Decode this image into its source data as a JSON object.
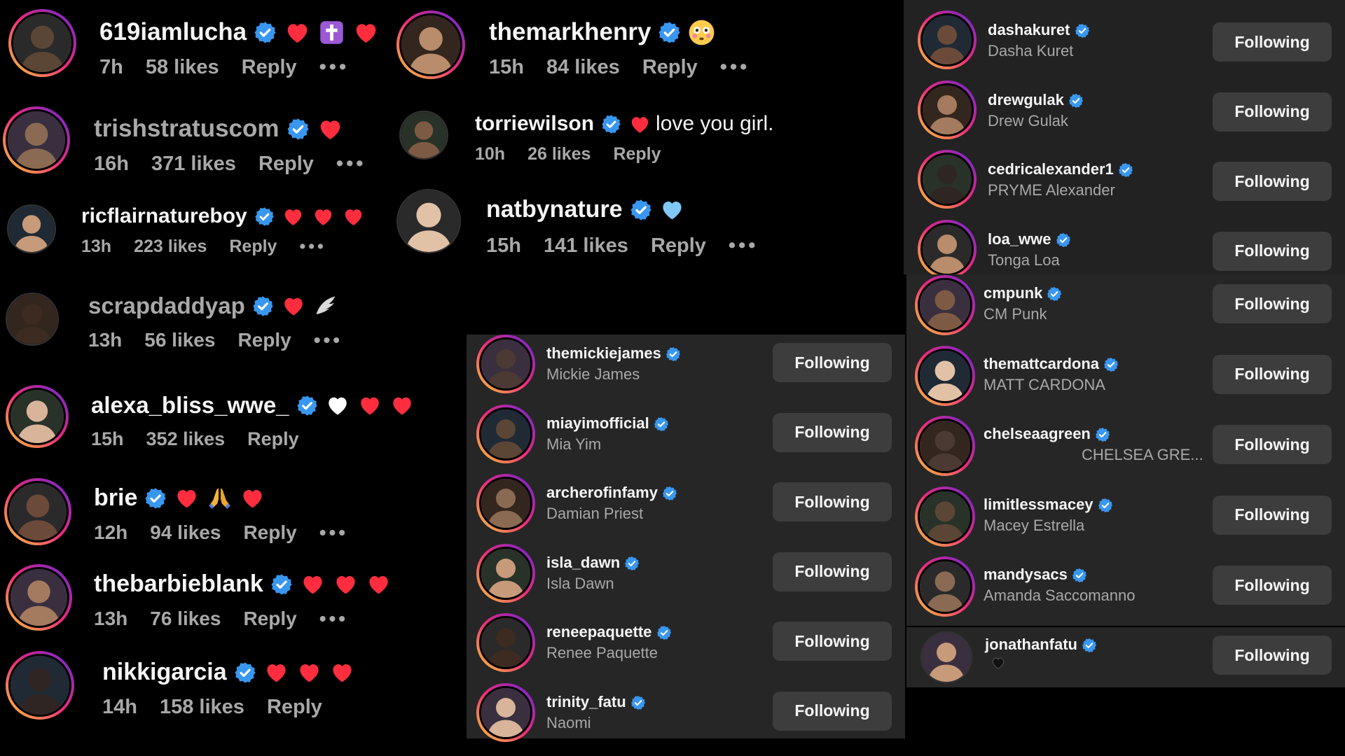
{
  "comments_col1": [
    {
      "user": "619iamlucha",
      "text": "",
      "time": "7h",
      "likes": "58 likes",
      "reply": "Reply",
      "emojis": [
        "heart-icon",
        "cross-icon",
        "heart-icon"
      ]
    },
    {
      "user": "trishstratuscom",
      "text": "",
      "time": "16h",
      "likes": "371 likes",
      "reply": "Reply",
      "emojis": [
        "heart-icon"
      ]
    },
    {
      "user": "ricflairnatureboy",
      "text": "",
      "time": "13h",
      "likes": "223 likes",
      "reply": "Reply",
      "emojis": [
        "heart-icon",
        "heart-icon",
        "heart-icon"
      ]
    },
    {
      "user": "scrapdaddyap",
      "text": "",
      "time": "13h",
      "likes": "56 likes",
      "reply": "Reply",
      "emojis": [
        "heart-icon",
        "wing-icon"
      ]
    },
    {
      "user": "alexa_bliss_wwe_",
      "text": "",
      "time": "15h",
      "likes": "352 likes",
      "reply": "Reply",
      "emojis": [
        "white-heart-icon",
        "heart-icon",
        "heart-icon"
      ]
    },
    {
      "user": "brie",
      "text": "",
      "time": "12h",
      "likes": "94 likes",
      "reply": "Reply",
      "emojis": [
        "heart-icon",
        "folded-hands-icon",
        "heart-icon"
      ]
    },
    {
      "user": "thebarbieblank",
      "text": "",
      "time": "13h",
      "likes": "76 likes",
      "reply": "Reply",
      "emojis": [
        "heart-icon",
        "heart-icon",
        "heart-icon"
      ]
    },
    {
      "user": "nikkigarcia",
      "text": "",
      "time": "14h",
      "likes": "158 likes",
      "reply": "Reply",
      "emojis": [
        "heart-icon",
        "heart-icon",
        "heart-icon"
      ]
    }
  ],
  "comments_col2": [
    {
      "user": "themarkhenry",
      "text": "",
      "time": "15h",
      "likes": "84 likes",
      "reply": "Reply",
      "emojis": [
        "flushed-face-icon"
      ]
    },
    {
      "user": "torriewilson",
      "text": "love you girl.",
      "time": "10h",
      "likes": "26 likes",
      "reply": "Reply",
      "emojis": [
        "heart-icon"
      ]
    },
    {
      "user": "natbynature",
      "text": "",
      "time": "15h",
      "likes": "141 likes",
      "reply": "Reply",
      "emojis": [
        "blue-heart-icon"
      ]
    }
  ],
  "following_mid": [
    {
      "user": "themickiejames",
      "name": "Mickie James",
      "button": "Following"
    },
    {
      "user": "miayimofficial",
      "name": "Mia Yim",
      "button": "Following"
    },
    {
      "user": "archerofinfamy",
      "name": "Damian Priest",
      "button": "Following"
    },
    {
      "user": "isla_dawn",
      "name": "Isla Dawn",
      "button": "Following"
    },
    {
      "user": "reneepaquette",
      "name": "Renee Paquette",
      "button": "Following"
    },
    {
      "user": "trinity_fatu",
      "name": "Naomi",
      "button": "Following"
    }
  ],
  "following_right_top": [
    {
      "user": "dashakuret",
      "name": "Dasha Kuret",
      "button": "Following"
    },
    {
      "user": "drewgulak",
      "name": "Drew Gulak",
      "button": "Following"
    },
    {
      "user": "cedricalexander1",
      "name": "PRYME Alexander",
      "button": "Following"
    },
    {
      "user": "loa_wwe",
      "name": "Tonga Loa",
      "button": "Following"
    }
  ],
  "following_right_mid": [
    {
      "user": "cmpunk",
      "name": "CM Punk",
      "button": "Following"
    },
    {
      "user": "themattcardona",
      "name": "MATT CARDONA",
      "button": "Following"
    },
    {
      "user": "chelseaagreen",
      "name": "CHELSEA GRE...",
      "button": "Following"
    },
    {
      "user": "limitlessmacey",
      "name": "Macey Estrella",
      "button": "Following"
    },
    {
      "user": "mandysacs",
      "name": "Amanda Saccomanno",
      "button": "Following"
    }
  ],
  "following_right_bottom": [
    {
      "user": "jonathanfatu",
      "name": "",
      "button": "Following"
    }
  ],
  "more_label": "•••",
  "colors": {
    "accent_blue": "#3897f0",
    "heart_red": "#ff3040",
    "muted": "#a8a8a8",
    "panel": "#262626",
    "button": "#3d3d3d"
  }
}
